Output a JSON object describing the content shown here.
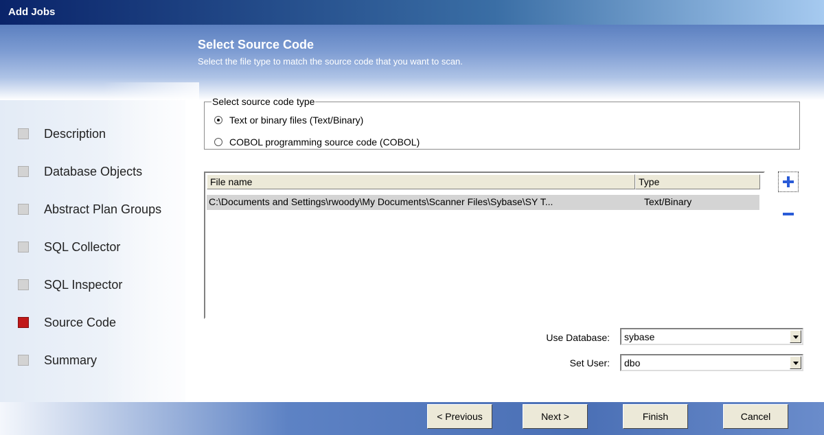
{
  "window": {
    "title": "Add Jobs"
  },
  "header": {
    "title": "Select Source Code",
    "subtitle": "Select the file type to match the source code that you want to scan."
  },
  "nav": {
    "items": [
      {
        "label": "Description",
        "active": false
      },
      {
        "label": "Database Objects",
        "active": false
      },
      {
        "label": "Abstract Plan Groups",
        "active": false
      },
      {
        "label": "SQL Collector",
        "active": false
      },
      {
        "label": "SQL Inspector",
        "active": false
      },
      {
        "label": "Source Code",
        "active": true
      },
      {
        "label": "Summary",
        "active": false
      }
    ]
  },
  "source_type": {
    "legend": "Select source code type",
    "options": [
      {
        "label": "Text or binary files  (Text/Binary)",
        "selected": true
      },
      {
        "label": "COBOL programming source code  (COBOL)",
        "selected": false
      }
    ]
  },
  "file_table": {
    "columns": [
      "File name",
      "Type"
    ],
    "rows": [
      {
        "file": "C:\\Documents and Settings\\rwoody\\My Documents\\Scanner Files\\Sybase\\SY T...",
        "type": "Text/Binary"
      }
    ]
  },
  "icons": {
    "add": "plus-icon",
    "remove": "minus-icon"
  },
  "fields": {
    "use_database": {
      "label": "Use Database:",
      "value": "sybase"
    },
    "set_user": {
      "label": "Set User:",
      "value": "dbo"
    }
  },
  "buttons": {
    "previous": "< Previous",
    "next": "Next >",
    "finish": "Finish",
    "cancel": "Cancel"
  },
  "colors": {
    "accent": "#2a5bd7",
    "active_step": "#c01818"
  }
}
